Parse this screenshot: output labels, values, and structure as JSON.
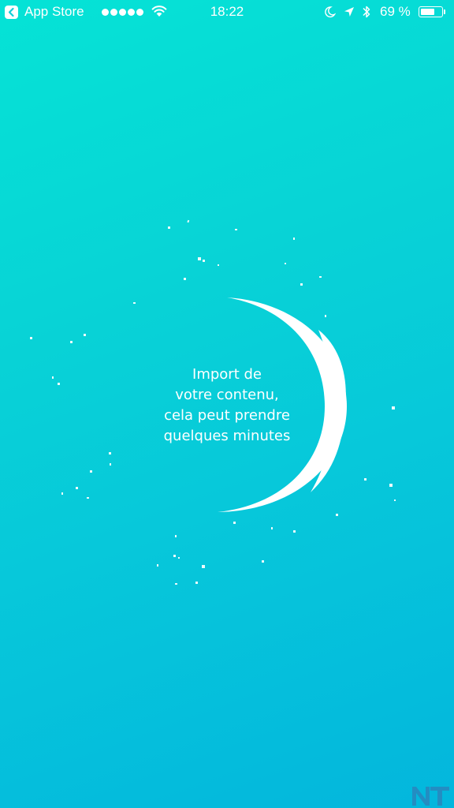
{
  "status_bar": {
    "back_app_label": "App Store",
    "signal_dots": 5,
    "time": "18:22",
    "battery_percent_label": "69 %",
    "battery_level": 0.69,
    "icons": [
      "back-arrow-icon",
      "wifi-icon",
      "do-not-disturb-moon-icon",
      "location-arrow-icon",
      "bluetooth-icon",
      "battery-icon"
    ]
  },
  "loading": {
    "message_lines": [
      "Import de",
      "votre contenu,",
      "cela peut prendre",
      "quelques minutes"
    ]
  },
  "watermark": {
    "text": "NT"
  },
  "colors": {
    "background_top": "#05e3d6",
    "background_bottom": "#03b6dd",
    "foreground": "#ffffff"
  }
}
